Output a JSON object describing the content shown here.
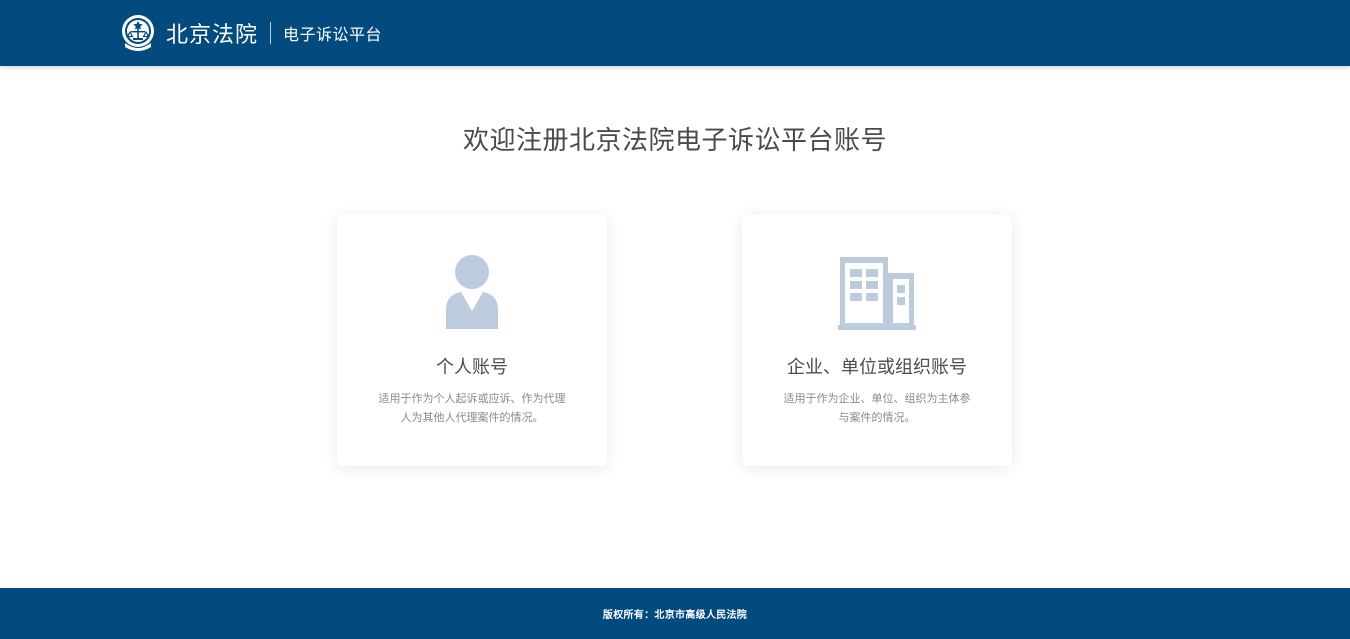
{
  "header": {
    "brand_name": "北京法院",
    "brand_sub": "电子诉讼平台",
    "emblem_icon": "court-emblem-icon",
    "background_color": "#034a7e"
  },
  "main": {
    "title": "欢迎注册北京法院电子诉讼平台账号"
  },
  "cards": [
    {
      "icon": "person-icon",
      "title": "个人账号",
      "desc_lines": [
        "适用于作为个人起诉或应诉、作为代理",
        "人为其他人代理案件的情况。"
      ]
    },
    {
      "icon": "building-icon",
      "title": "企业、单位或组织账号",
      "desc_lines": [
        "适用于作为企业、单位、组织为主体参",
        "与案件的情况。"
      ]
    }
  ],
  "footer": {
    "copyright": "版权所有：北京市高级人民法院",
    "background_color": "#034a7e"
  },
  "colors": {
    "icon_fill": "#bccbdd",
    "title_text": "#4a4a4a",
    "desc_text": "#8a8a8a"
  }
}
